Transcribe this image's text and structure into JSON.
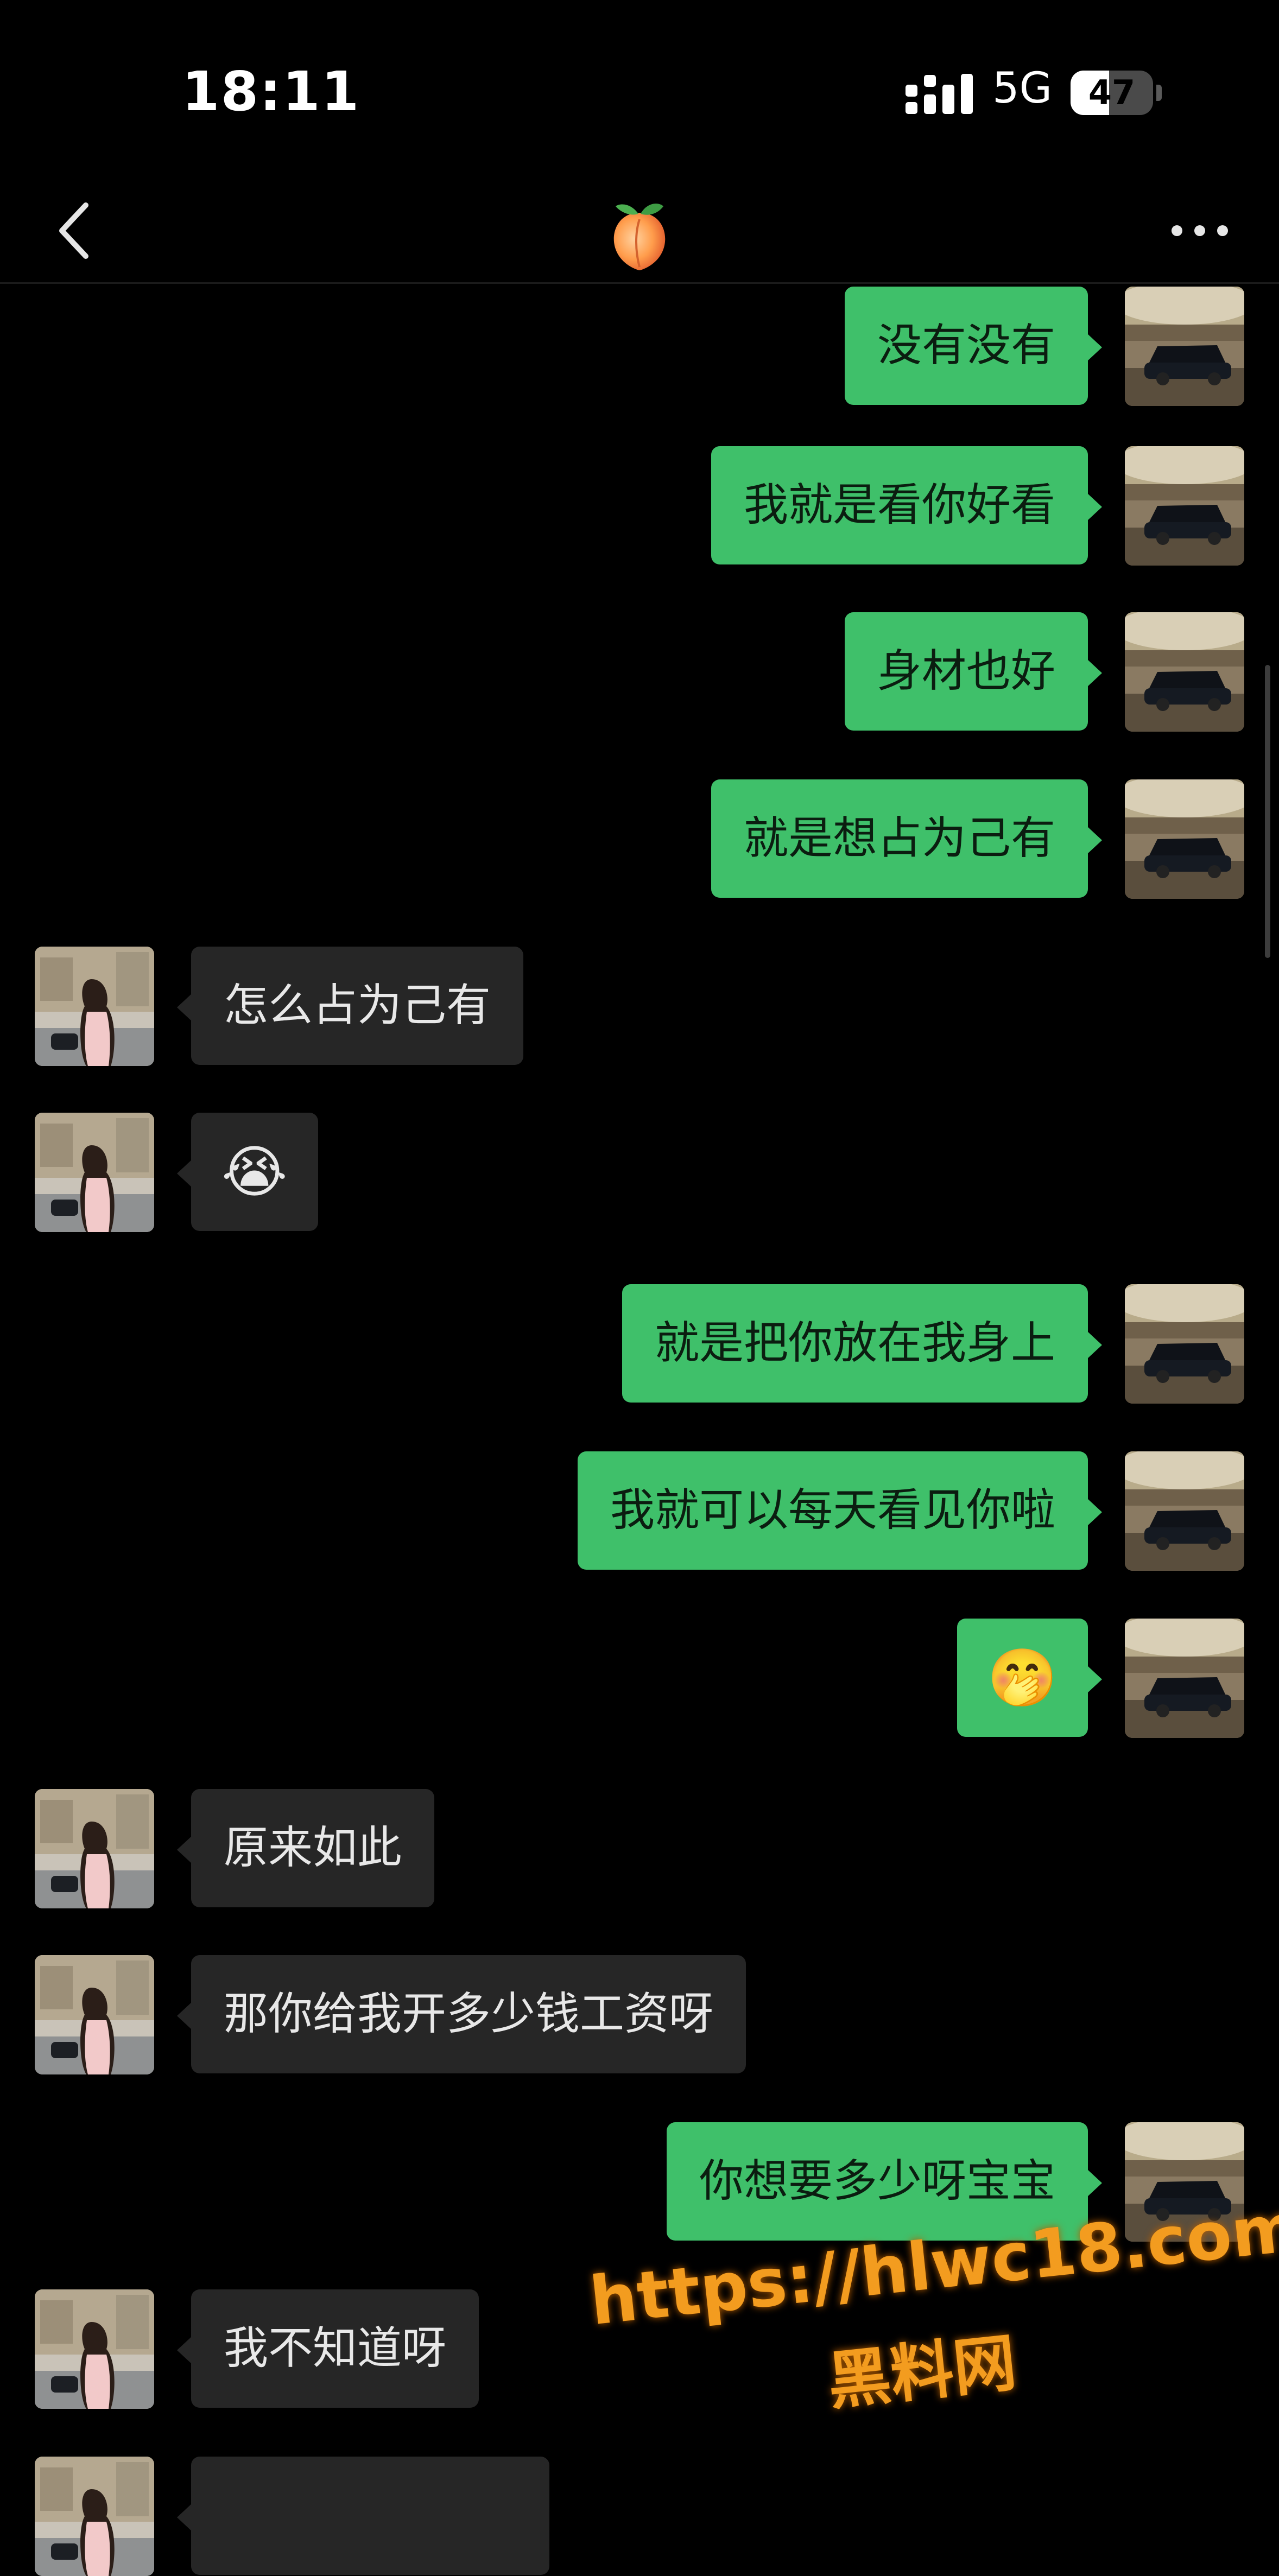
{
  "status_bar": {
    "time": "18:11",
    "network": "5G",
    "battery_level": "47",
    "battery_fraction": 0.47
  },
  "nav": {
    "back_icon": "chevron-left-icon",
    "title_emoji": "🍑",
    "more_icon": "ellipsis-icon"
  },
  "messages": [
    {
      "sender": "me",
      "text": "没有没有"
    },
    {
      "sender": "me",
      "text": "我就是看你好看"
    },
    {
      "sender": "me",
      "text": "身材也好"
    },
    {
      "sender": "me",
      "text": "就是想占为己有"
    },
    {
      "sender": "peer",
      "text": "怎么占为己有"
    },
    {
      "sender": "peer",
      "text": "😭"
    },
    {
      "sender": "me",
      "text": "就是把你放在我身上"
    },
    {
      "sender": "me",
      "text": "我就可以每天看见你啦"
    },
    {
      "sender": "me",
      "text": "🤭"
    },
    {
      "sender": "peer",
      "text": "原来如此"
    },
    {
      "sender": "peer",
      "text": "那你给我开多少钱工资呀"
    },
    {
      "sender": "me",
      "text": "你想要多少呀宝宝"
    },
    {
      "sender": "peer",
      "text": "我不知道呀"
    },
    {
      "sender": "peer",
      "text": ""
    }
  ],
  "watermark": {
    "url": "https://hlwc18.com",
    "name": "黑料网"
  },
  "colors": {
    "background": "#000000",
    "my_bubble": "#3fc06a",
    "peer_bubble": "#262626",
    "watermark": "#f39c1f"
  }
}
